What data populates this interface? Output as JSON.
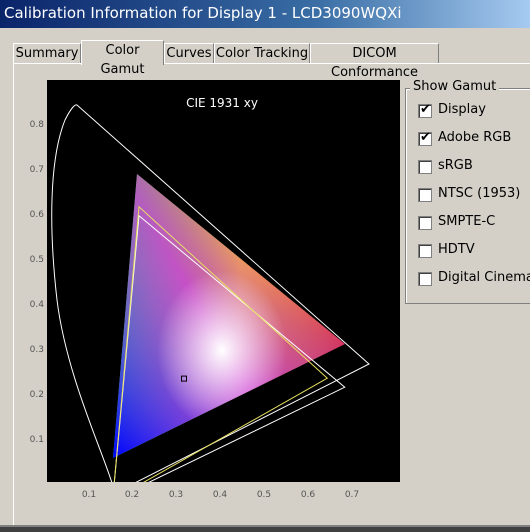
{
  "window": {
    "title": "Calibration Information for Display 1 - LCD3090WQXi"
  },
  "tabs": [
    {
      "label": "Summary"
    },
    {
      "label": "Color Gamut"
    },
    {
      "label": "Curves"
    },
    {
      "label": "Color Tracking"
    },
    {
      "label": "DICOM Conformance"
    }
  ],
  "active_tab": "Color Gamut",
  "chart_data": {
    "type": "scatter",
    "title": "CIE 1931 xy",
    "xlim": [
      0,
      0.8
    ],
    "ylim": [
      0,
      0.9
    ],
    "x_ticks": [
      "0.1",
      "0.2",
      "0.3",
      "0.4",
      "0.5",
      "0.6",
      "0.7"
    ],
    "y_ticks": [
      "0.8",
      "0.7",
      "0.6",
      "0.5",
      "0.4",
      "0.3",
      "0.2",
      "0.1"
    ],
    "grid": false,
    "series": [
      {
        "x": [
          0.68,
          0.21,
          0.15
        ],
        "y": [
          0.31,
          0.69,
          0.06
        ]
      },
      {
        "x": [
          0.64,
          0.21,
          0.15
        ],
        "y": [
          0.33,
          0.71,
          0.06
        ]
      }
    ],
    "white_point": {
      "x": 0.3127,
      "y": 0.329
    }
  },
  "gamut_group": {
    "title": "Show Gamut",
    "options": [
      {
        "label": "Display",
        "checked": true
      },
      {
        "label": "Adobe RGB",
        "checked": true
      },
      {
        "label": "sRGB",
        "checked": false
      },
      {
        "label": "NTSC (1953)",
        "checked": false
      },
      {
        "label": "SMPTE-C",
        "checked": false
      },
      {
        "label": "HDTV",
        "checked": false
      },
      {
        "label": "Digital Cinema",
        "checked": false
      }
    ]
  }
}
